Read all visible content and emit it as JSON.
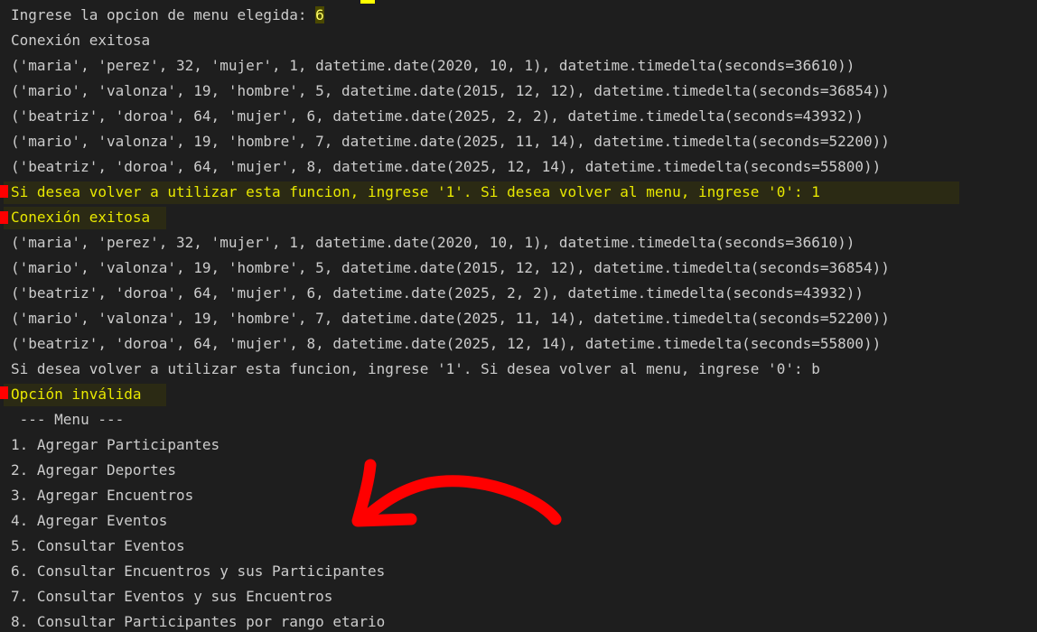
{
  "terminal": {
    "prompt_label": "Ingrese la opcion de menu elegida: ",
    "prompt_value": "6",
    "lines": [
      "Conexión exitosa",
      "('maria', 'perez', 32, 'mujer', 1, datetime.date(2020, 10, 1), datetime.timedelta(seconds=36610))",
      "('mario', 'valonza', 19, 'hombre', 5, datetime.date(2015, 12, 12), datetime.timedelta(seconds=36854))",
      "('beatriz', 'doroa', 64, 'mujer', 6, datetime.date(2025, 2, 2), datetime.timedelta(seconds=43932))",
      "('mario', 'valonza', 19, 'hombre', 7, datetime.date(2025, 11, 14), datetime.timedelta(seconds=52200))",
      "('beatriz', 'doroa', 64, 'mujer', 8, datetime.date(2025, 12, 14), datetime.timedelta(seconds=55800))",
      "Si desea volver a utilizar esta funcion, ingrese '1'. Si desea volver al menu, ingrese '0': 1",
      "Conexión exitosa",
      "('maria', 'perez', 32, 'mujer', 1, datetime.date(2020, 10, 1), datetime.timedelta(seconds=36610))",
      "('mario', 'valonza', 19, 'hombre', 5, datetime.date(2015, 12, 12), datetime.timedelta(seconds=36854))",
      "('beatriz', 'doroa', 64, 'mujer', 6, datetime.date(2025, 2, 2), datetime.timedelta(seconds=43932))",
      "('mario', 'valonza', 19, 'hombre', 7, datetime.date(2025, 11, 14), datetime.timedelta(seconds=52200))",
      "('beatriz', 'doroa', 64, 'mujer', 8, datetime.date(2025, 12, 14), datetime.timedelta(seconds=55800))",
      "Si desea volver a utilizar esta funcion, ingrese '1'. Si desea volver al menu, ingrese '0': b",
      "Opción inválida",
      " --- Menu ---",
      "1. Agregar Participantes",
      "2. Agregar Deportes",
      "3. Agregar Encuentros",
      "4. Agregar Eventos",
      "5. Consultar Eventos",
      "6. Consultar Encuentros y sus Participantes",
      "7. Consultar Eventos y sus Encuentros",
      "8. Consultar Participantes por rango etario"
    ]
  },
  "colors": {
    "background": "#1e1e1e",
    "text": "#cccccc",
    "highlight_text": "#e8e800",
    "annotation_arrow": "#ff0000"
  },
  "annotations": {
    "arrow_icon": "red-hand-drawn-arrow-left"
  }
}
